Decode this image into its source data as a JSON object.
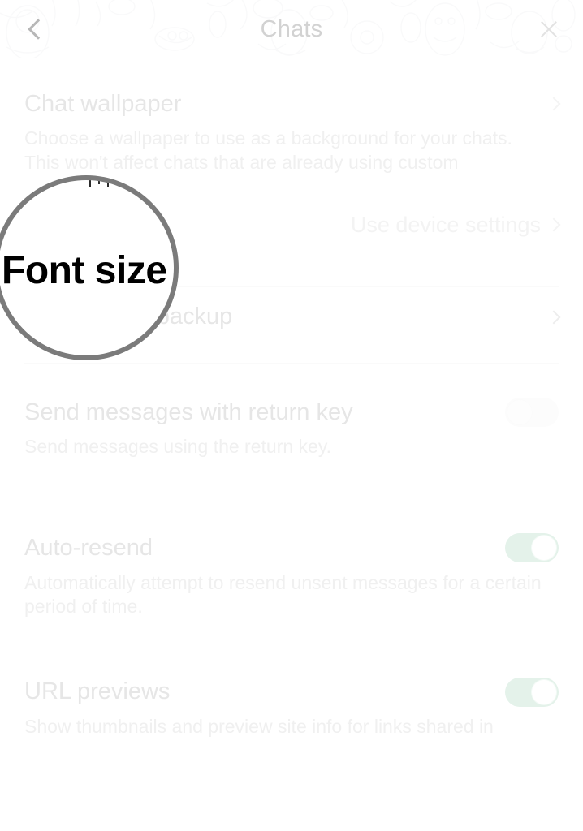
{
  "header": {
    "title": "Chats",
    "back_icon": "chevron-left-icon",
    "close_icon": "close-icon"
  },
  "magnifier": {
    "label": "Font size"
  },
  "settings": {
    "chat_wallpaper": {
      "title": "Chat wallpaper",
      "description": "Choose a wallpaper to use as a background for your chats. This won't affect chats that are already using custom",
      "chevron_icon": "chevron-right-icon"
    },
    "font_size": {
      "title": "Font size",
      "value": "Use device settings",
      "chevron_icon": "chevron-right-icon"
    },
    "chat_history_backup": {
      "title": "Chat history backup",
      "chevron_icon": "chevron-right-icon"
    },
    "send_with_return_key": {
      "title": "Send messages with return key",
      "description": "Send messages using the return key.",
      "toggle_state": "off"
    },
    "auto_resend": {
      "title": "Auto-resend",
      "description": "Automatically attempt to resend unsent messages for a certain period of time.",
      "toggle_state": "on"
    },
    "url_previews": {
      "title": "URL previews",
      "description": "Show thumbnails and preview site info for links shared in",
      "toggle_state": "on"
    }
  },
  "colors": {
    "toggle_on": "#e4f2ea",
    "magnifier_border": "#7b7b7b",
    "faded_text": "#e6e6e6",
    "background": "#ffffff"
  }
}
